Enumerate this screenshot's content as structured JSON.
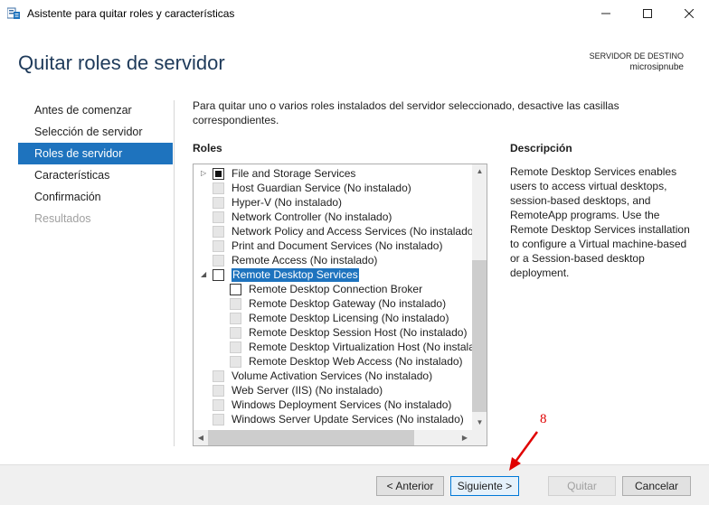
{
  "window": {
    "title": "Asistente para quitar roles y características",
    "minimize_glyph": "—",
    "maximize_glyph": "☐",
    "close_glyph": "✕",
    "icon": "server-manager-icon"
  },
  "header": {
    "page_title": "Quitar roles de servidor",
    "destination_label": "SERVIDOR DE DESTINO",
    "destination_server": "microsipnube"
  },
  "nav": {
    "items": [
      {
        "label": "Antes de comenzar",
        "state": "normal"
      },
      {
        "label": "Selección de servidor",
        "state": "normal"
      },
      {
        "label": "Roles de servidor",
        "state": "active"
      },
      {
        "label": "Características",
        "state": "normal"
      },
      {
        "label": "Confirmación",
        "state": "normal"
      },
      {
        "label": "Resultados",
        "state": "disabled"
      }
    ]
  },
  "main": {
    "intro": "Para quitar uno o varios roles instalados del servidor seleccionado, desactive las casillas correspondientes.",
    "roles_label": "Roles",
    "description_label": "Descripción",
    "description_text": "Remote Desktop Services enables users to access virtual desktops, session-based desktops, and RemoteApp programs. Use the Remote Desktop Services installation to configure a Virtual machine-based or a Session-based desktop deployment."
  },
  "roles": [
    {
      "label": "File and Storage Services",
      "level": 0,
      "expander": "collapsed",
      "checkbox": "partial",
      "enabled": true,
      "selected": false
    },
    {
      "label": "Host Guardian Service (No instalado)",
      "level": 0,
      "expander": "none",
      "checkbox": "unchecked",
      "enabled": false,
      "selected": false
    },
    {
      "label": "Hyper-V (No instalado)",
      "level": 0,
      "expander": "none",
      "checkbox": "unchecked",
      "enabled": false,
      "selected": false
    },
    {
      "label": "Network Controller (No instalado)",
      "level": 0,
      "expander": "none",
      "checkbox": "unchecked",
      "enabled": false,
      "selected": false
    },
    {
      "label": "Network Policy and Access Services (No instalado)",
      "level": 0,
      "expander": "none",
      "checkbox": "unchecked",
      "enabled": false,
      "selected": false
    },
    {
      "label": "Print and Document Services (No instalado)",
      "level": 0,
      "expander": "none",
      "checkbox": "unchecked",
      "enabled": false,
      "selected": false
    },
    {
      "label": "Remote Access (No instalado)",
      "level": 0,
      "expander": "none",
      "checkbox": "unchecked",
      "enabled": false,
      "selected": false
    },
    {
      "label": "Remote Desktop Services",
      "level": 0,
      "expander": "expanded",
      "checkbox": "unchecked",
      "enabled": true,
      "selected": true
    },
    {
      "label": "Remote Desktop Connection Broker",
      "level": 1,
      "expander": "none",
      "checkbox": "unchecked",
      "enabled": true,
      "selected": false
    },
    {
      "label": "Remote Desktop Gateway (No instalado)",
      "level": 1,
      "expander": "none",
      "checkbox": "unchecked",
      "enabled": false,
      "selected": false
    },
    {
      "label": "Remote Desktop Licensing (No instalado)",
      "level": 1,
      "expander": "none",
      "checkbox": "unchecked",
      "enabled": false,
      "selected": false
    },
    {
      "label": "Remote Desktop Session Host (No instalado)",
      "level": 1,
      "expander": "none",
      "checkbox": "unchecked",
      "enabled": false,
      "selected": false
    },
    {
      "label": "Remote Desktop Virtualization Host (No instalado)",
      "level": 1,
      "expander": "none",
      "checkbox": "unchecked",
      "enabled": false,
      "selected": false
    },
    {
      "label": "Remote Desktop Web Access (No instalado)",
      "level": 1,
      "expander": "none",
      "checkbox": "unchecked",
      "enabled": false,
      "selected": false
    },
    {
      "label": "Volume Activation Services (No instalado)",
      "level": 0,
      "expander": "none",
      "checkbox": "unchecked",
      "enabled": false,
      "selected": false
    },
    {
      "label": "Web Server (IIS) (No instalado)",
      "level": 0,
      "expander": "none",
      "checkbox": "unchecked",
      "enabled": false,
      "selected": false
    },
    {
      "label": "Windows Deployment Services (No instalado)",
      "level": 0,
      "expander": "none",
      "checkbox": "unchecked",
      "enabled": false,
      "selected": false
    },
    {
      "label": "Windows Server Update Services (No instalado)",
      "level": 0,
      "expander": "none",
      "checkbox": "unchecked",
      "enabled": false,
      "selected": false
    }
  ],
  "scrollbars": {
    "up_glyph": "▲",
    "down_glyph": "▼",
    "left_glyph": "◀",
    "right_glyph": "▶"
  },
  "footer": {
    "back_label": "< Anterior",
    "next_label": "Siguiente >",
    "remove_label": "Quitar",
    "cancel_label": "Cancelar"
  },
  "annotation": {
    "step_number": "8",
    "color": "#e00000"
  },
  "colors": {
    "accent": "#1e73be",
    "title": "#1e3a5a",
    "annotation": "#e00000"
  }
}
